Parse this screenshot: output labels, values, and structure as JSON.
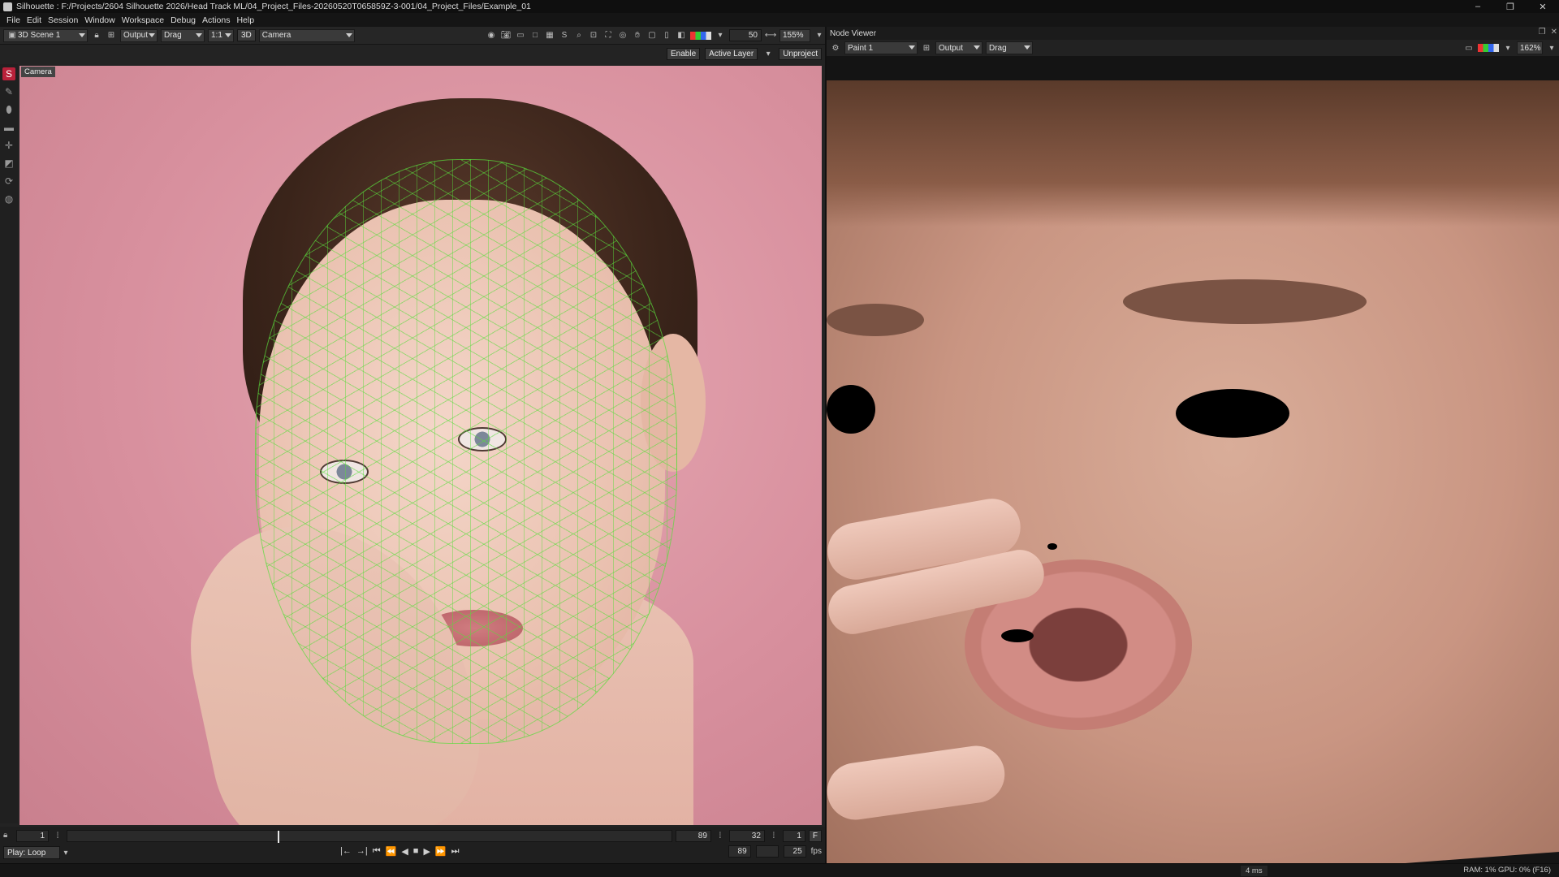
{
  "window": {
    "title": "Silhouette : F:/Projects/2604 Silhouette 2026/Head Track ML/04_Project_Files-20260520T065859Z-3-001/04_Project_Files/Example_01",
    "controls": [
      "–",
      "❐",
      "✕"
    ]
  },
  "menu": [
    "File",
    "Edit",
    "Session",
    "Window",
    "Workspace",
    "Debug",
    "Actions",
    "Help"
  ],
  "left_viewer": {
    "scene_select": "3D Scene 1",
    "output_select": "Output",
    "mode_select": "Drag",
    "ratio_select": "1:1",
    "view_3d_label": "3D",
    "camera_select": "Camera",
    "exposure_value": "50",
    "zoom": "155%",
    "sub_buttons": {
      "enable": "Enable",
      "active_layer": "Active Layer",
      "unproject": "Unproject"
    },
    "viewer_tag": "Camera"
  },
  "timeline": {
    "start_frame": "1",
    "end_frame": "89",
    "current_frame": "32",
    "step": "1",
    "f_label": "F",
    "play_mode": "Play: Loop",
    "duration": "89",
    "fps_value": "25",
    "fps_label": "fps",
    "transport": [
      "|←",
      "→|",
      "⏮",
      "⏪",
      "◀",
      "■",
      "▶",
      "⏩",
      "⏭"
    ]
  },
  "right_viewer": {
    "title": "Node Viewer",
    "node_select": "Paint 1",
    "output_select": "Output",
    "mode_select": "Drag",
    "zoom": "162%"
  },
  "status": {
    "render_time": "4 ms",
    "memory": "RAM: 1% GPU: 0% (F16)"
  },
  "tools_left": [
    "silhouette-logo",
    "paint",
    "blob",
    "rect",
    "transform",
    "scale",
    "rotate",
    "globe"
  ]
}
